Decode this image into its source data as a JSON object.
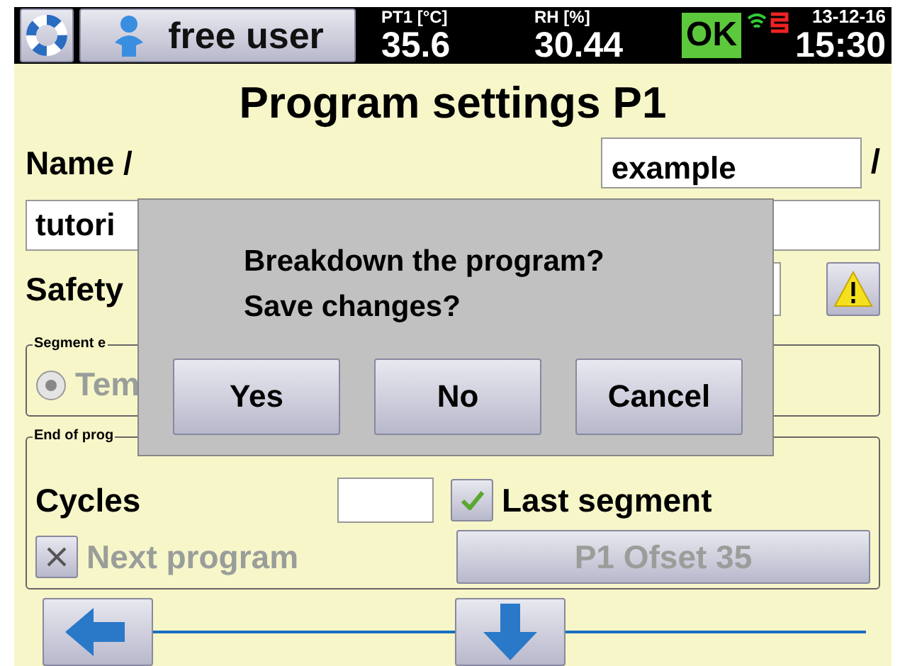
{
  "status_bar": {
    "user": "free user",
    "readings": [
      {
        "label": "PT1 [°C]",
        "value": "35.6"
      },
      {
        "label": "RH [%]",
        "value": "30.44"
      }
    ],
    "status": "OK",
    "date": "13-12-16",
    "time": "15:30"
  },
  "title": "Program settings P1",
  "name_label": "Name /",
  "name_field": {
    "value": "example"
  },
  "name_separator": "/",
  "description_field": {
    "value": "tutori"
  },
  "safety_label": "Safety",
  "segment_end": {
    "legend": "Segment e",
    "options": [
      {
        "label": "Tem",
        "selected": true,
        "disabled": true
      }
    ]
  },
  "end_of_program": {
    "legend": "End of prog",
    "cycles_label": "Cycles",
    "last_segment": {
      "label": "Last segment",
      "checked": true,
      "disabled": false
    },
    "next_program": {
      "label": "Next program",
      "checked": true,
      "disabled": true
    },
    "program_button": {
      "label": "P1 Ofset 35",
      "disabled": true
    }
  },
  "dialog": {
    "lines": [
      "Breakdown the program?",
      "Save changes?"
    ],
    "buttons": [
      "Yes",
      "No",
      "Cancel"
    ]
  }
}
